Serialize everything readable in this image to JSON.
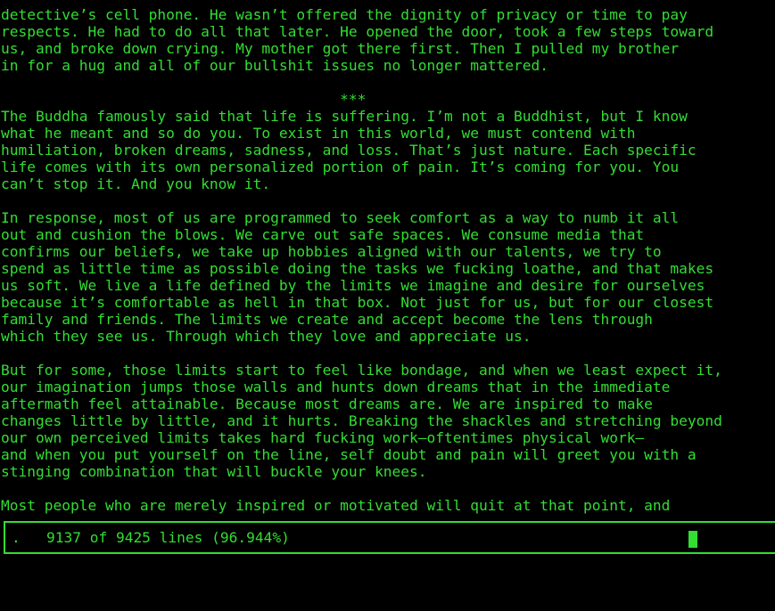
{
  "pager": {
    "lines": [
      "detective’s cell phone. He wasn’t offered the dignity of privacy or time to pay",
      "respects. He had to do all that later. He opened the door, took a few steps toward",
      "us, and broke down crying. My mother got there first. Then I pulled my brother",
      "in for a hug and all of our bullshit issues no longer mattered.",
      "",
      "                                       ***",
      "The Buddha famously said that life is suffering. I’m not a Buddhist, but I know",
      "what he meant and so do you. To exist in this world, we must contend with",
      "humiliation, broken dreams, sadness, and loss. That’s just nature. Each specific",
      "life comes with its own personalized portion of pain. It’s coming for you. You",
      "can’t stop it. And you know it.",
      "",
      "In response, most of us are programmed to seek comfort as a way to numb it all",
      "out and cushion the blows. We carve out safe spaces. We consume media that",
      "confirms our beliefs, we take up hobbies aligned with our talents, we try to",
      "spend as little time as possible doing the tasks we fucking loathe, and that makes",
      "us soft. We live a life defined by the limits we imagine and desire for ourselves",
      "because it’s comfortable as hell in that box. Not just for us, but for our closest",
      "family and friends. The limits we create and accept become the lens through",
      "which they see us. Through which they love and appreciate us.",
      "",
      "But for some, those limits start to feel like bondage, and when we least expect it,",
      "our imagination jumps those walls and hunts down dreams that in the immediate",
      "aftermath feel attainable. Because most dreams are. We are inspired to make",
      "changes little by little, and it hurts. Breaking the shackles and stretching beyond",
      "our own perceived limits takes hard fucking work—oftentimes physical work—",
      "and when you put yourself on the line, self doubt and pain will greet you with a",
      "stinging combination that will buckle your knees.",
      "",
      "Most people who are merely inspired or motivated will quit at that point, and"
    ]
  },
  "status": {
    "text": ".   9137 of 9425 lines (96.944%)"
  },
  "colors": {
    "foreground": "#33dd33",
    "background": "#000000"
  }
}
